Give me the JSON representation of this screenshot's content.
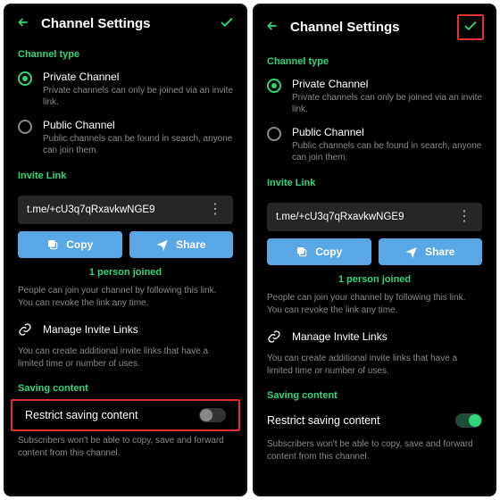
{
  "header": {
    "title": "Channel Settings"
  },
  "channel_type": {
    "heading": "Channel type",
    "private": {
      "label": "Private Channel",
      "desc": "Private channels can only be joined via an invite link."
    },
    "public": {
      "label": "Public Channel",
      "desc": "Public channels can be found in search, anyone can join them."
    }
  },
  "invite": {
    "heading": "Invite Link",
    "link": "t.me/+cU3q7qRxavkwNGE9",
    "copy": "Copy",
    "share": "Share",
    "joined": "1 person joined",
    "follow_text": "People can join your channel by following this link. You can revoke the link any time.",
    "manage": "Manage Invite Links",
    "manage_desc": "You can create additional invite links that have a limited time or number of uses."
  },
  "saving": {
    "heading": "Saving content",
    "toggle": "Restrict saving content",
    "desc": "Subscribers won't be able to copy, save and forward content from this channel."
  }
}
